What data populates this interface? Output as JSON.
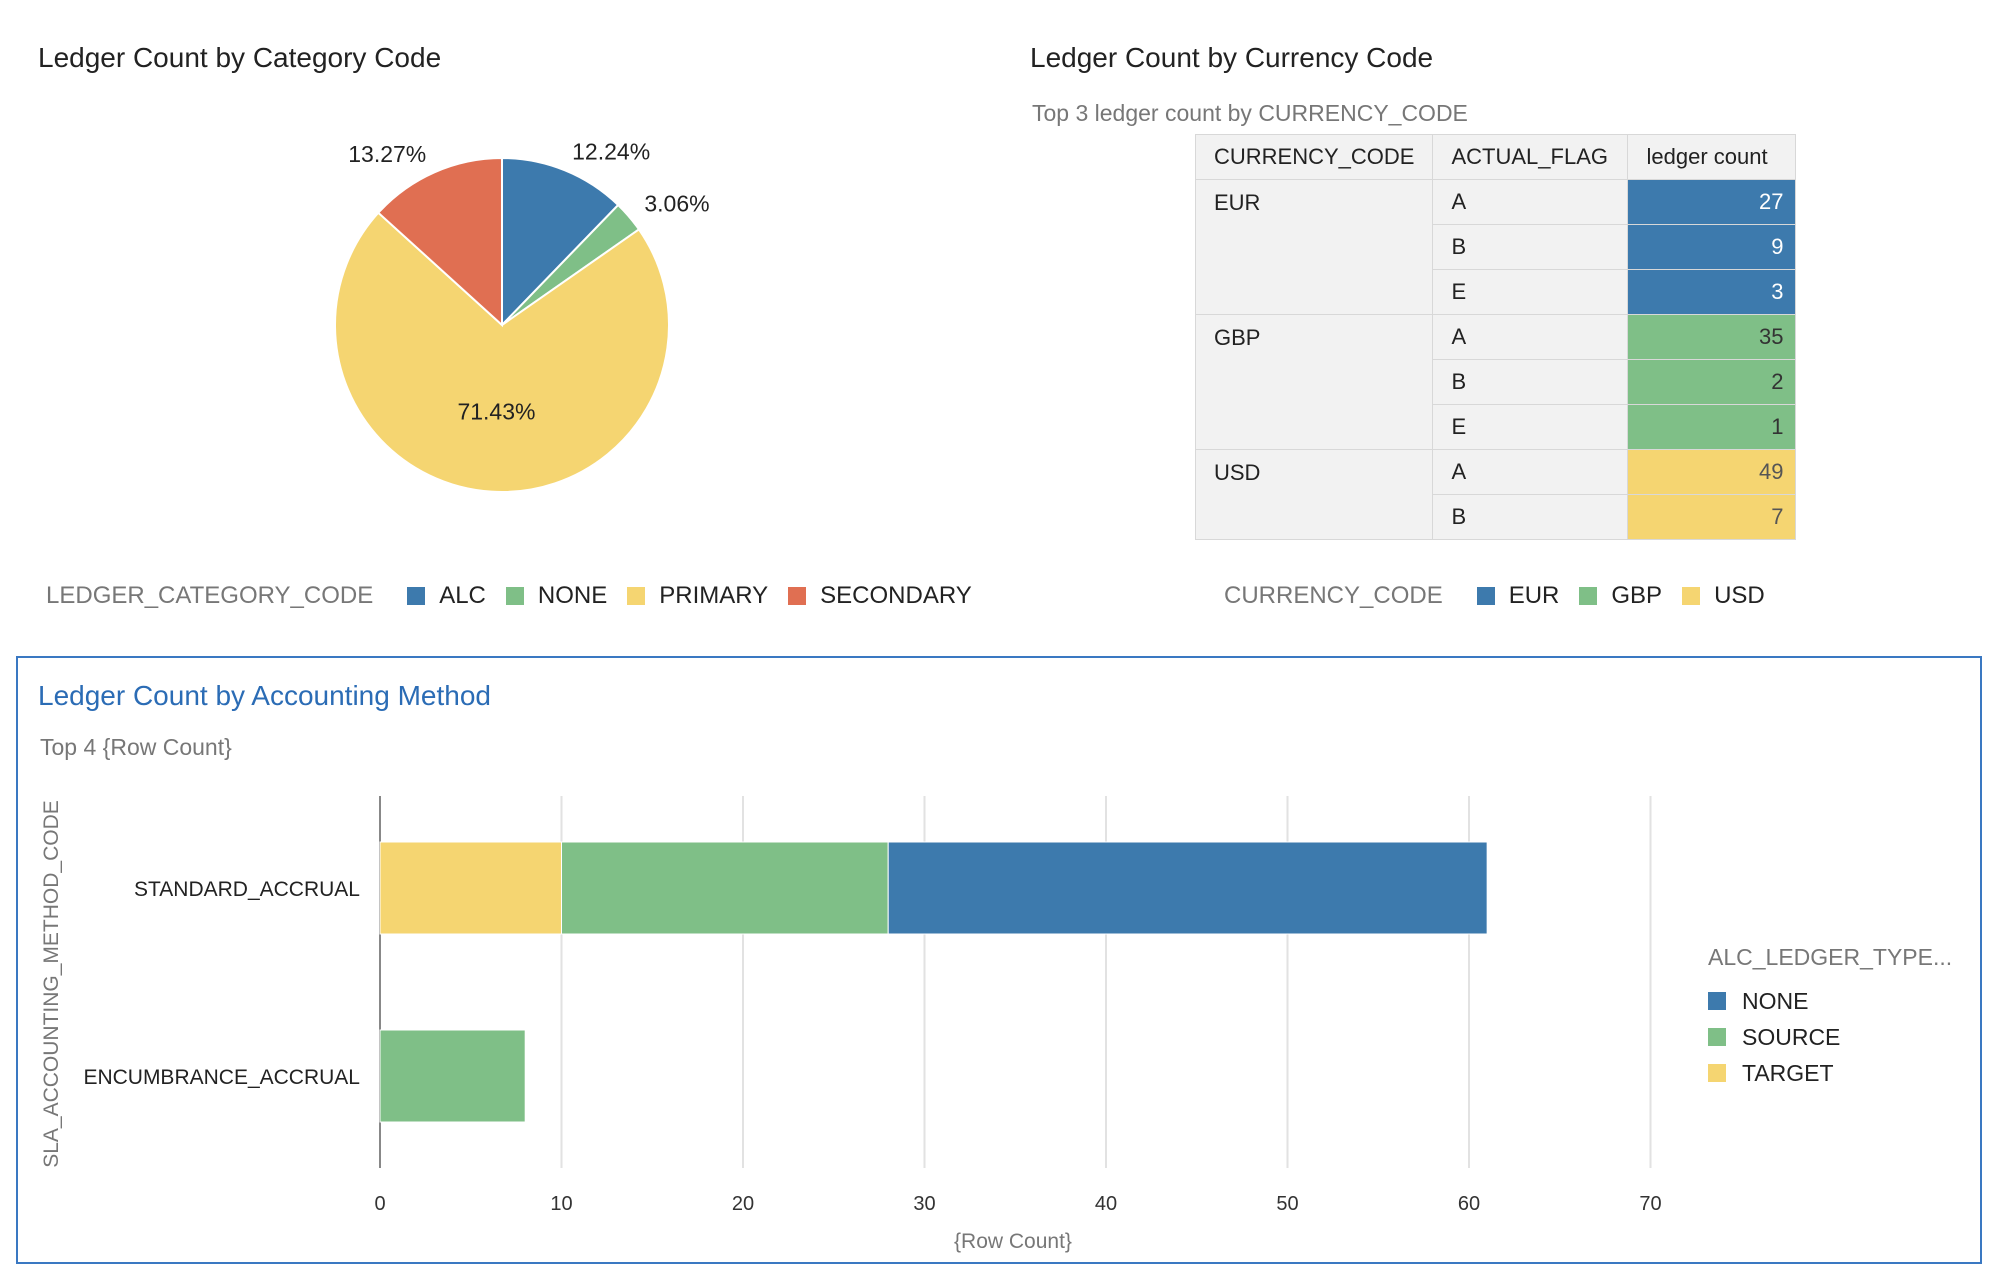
{
  "colors": {
    "blue": "#3d7aad",
    "green": "#7fbf87",
    "yellow": "#f5d571",
    "red": "#e06f52"
  },
  "pie_panel": {
    "title": "Ledger Count by Category Code",
    "legend_title": "LEDGER_CATEGORY_CODE",
    "legend": [
      {
        "label": "ALC",
        "color": "#3d7aad"
      },
      {
        "label": "NONE",
        "color": "#7fbf87"
      },
      {
        "label": "PRIMARY",
        "color": "#f5d571"
      },
      {
        "label": "SECONDARY",
        "color": "#e06f52"
      }
    ]
  },
  "table_panel": {
    "title": "Ledger Count by Currency Code",
    "subtitle": "Top 3 ledger count by CURRENCY_CODE",
    "headers": [
      "CURRENCY_CODE",
      "ACTUAL_FLAG",
      "ledger count"
    ],
    "groups": [
      {
        "currency": "EUR",
        "color": "#3d7aad",
        "text_color": "#ffffff",
        "rows": [
          {
            "flag": "A",
            "count": "27"
          },
          {
            "flag": "B",
            "count": "9"
          },
          {
            "flag": "E",
            "count": "3"
          }
        ]
      },
      {
        "currency": "GBP",
        "color": "#7fbf87",
        "text_color": "#333333",
        "rows": [
          {
            "flag": "A",
            "count": "35"
          },
          {
            "flag": "B",
            "count": "2"
          },
          {
            "flag": "E",
            "count": "1"
          }
        ]
      },
      {
        "currency": "USD",
        "color": "#f5d571",
        "text_color": "#555555",
        "rows": [
          {
            "flag": "A",
            "count": "49"
          },
          {
            "flag": "B",
            "count": "7"
          }
        ]
      }
    ],
    "legend_title": "CURRENCY_CODE",
    "legend": [
      {
        "label": "EUR",
        "color": "#3d7aad"
      },
      {
        "label": "GBP",
        "color": "#7fbf87"
      },
      {
        "label": "USD",
        "color": "#f5d571"
      }
    ]
  },
  "bar_panel": {
    "title": "Ledger Count by Accounting Method",
    "subtitle": "Top 4 {Row Count}",
    "legend_title": "ALC_LEDGER_TYPE...",
    "legend": [
      {
        "label": "NONE",
        "color": "#3d7aad"
      },
      {
        "label": "SOURCE",
        "color": "#7fbf87"
      },
      {
        "label": "TARGET",
        "color": "#f5d571"
      }
    ]
  },
  "chart_data": [
    {
      "type": "pie",
      "title": "Ledger Count by Category Code",
      "legend_title": "LEDGER_CATEGORY_CODE",
      "legend_position": "bottom",
      "slices": [
        {
          "label": "ALC",
          "value": 12.24,
          "display": "12.24%",
          "color": "#3d7aad"
        },
        {
          "label": "NONE",
          "value": 3.06,
          "display": "3.06%",
          "color": "#7fbf87"
        },
        {
          "label": "PRIMARY",
          "value": 71.43,
          "display": "71.43%",
          "color": "#f5d571"
        },
        {
          "label": "SECONDARY",
          "value": 13.27,
          "display": "13.27%",
          "color": "#e06f52"
        }
      ]
    },
    {
      "type": "table",
      "title": "Ledger Count by Currency Code",
      "subtitle": "Top 3 ledger count by CURRENCY_CODE",
      "columns": [
        "CURRENCY_CODE",
        "ACTUAL_FLAG",
        "ledger count"
      ],
      "rows": [
        [
          "EUR",
          "A",
          27
        ],
        [
          "EUR",
          "B",
          9
        ],
        [
          "EUR",
          "E",
          3
        ],
        [
          "GBP",
          "A",
          35
        ],
        [
          "GBP",
          "B",
          2
        ],
        [
          "GBP",
          "E",
          1
        ],
        [
          "USD",
          "A",
          49
        ],
        [
          "USD",
          "B",
          7
        ]
      ]
    },
    {
      "type": "bar",
      "orientation": "horizontal",
      "stacked": true,
      "title": "Ledger Count by Accounting Method",
      "subtitle": "Top 4 {Row Count}",
      "categories": [
        "STANDARD_ACCRUAL",
        "ENCUMBRANCE_ACCRUAL"
      ],
      "series": [
        {
          "name": "TARGET",
          "color": "#f5d571",
          "values": [
            10,
            0
          ]
        },
        {
          "name": "SOURCE",
          "color": "#7fbf87",
          "values": [
            18,
            8
          ]
        },
        {
          "name": "NONE",
          "color": "#3d7aad",
          "values": [
            33,
            0
          ]
        }
      ],
      "xlabel": "{Row Count}",
      "ylabel": "SLA_ACCOUNTING_METHOD_CODE",
      "xlim": [
        0,
        70
      ],
      "xticks": [
        0,
        10,
        20,
        30,
        40,
        50,
        60,
        70
      ],
      "grid": true,
      "legend_title": "ALC_LEDGER_TYPE...",
      "legend_position": "right"
    }
  ]
}
